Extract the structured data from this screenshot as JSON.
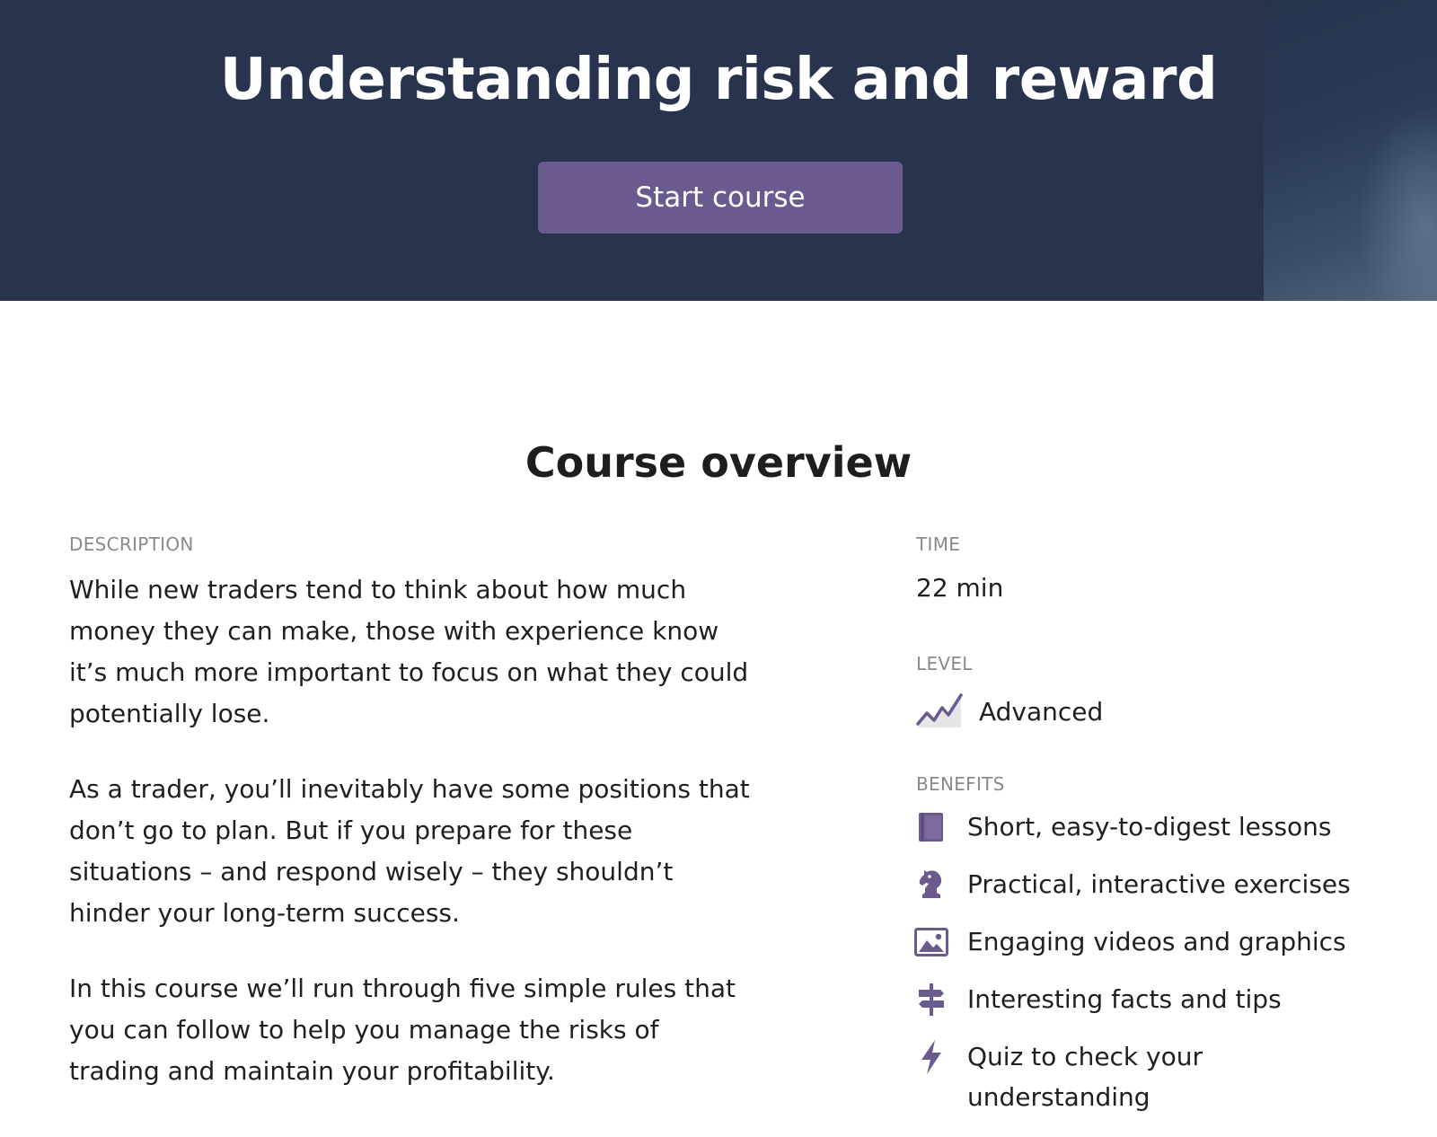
{
  "hero": {
    "title": "Understanding risk and reward",
    "start_button": "Start course"
  },
  "overview": {
    "title": "Course overview",
    "description_label": "DESCRIPTION",
    "paragraphs": [
      "While new traders tend to think about how much money they can make, those with experience know it’s much more important to focus on what they could potentially lose.",
      "As a trader, you’ll inevitably have some positions that don’t go to plan. But if you prepare for these situations – and respond wisely – they shouldn’t hinder your long-term success.",
      "In this course we’ll run through five simple rules that you can follow to help you manage the risks of trading and maintain your profitability."
    ],
    "time_label": "TIME",
    "time_value": "22 min",
    "level_label": "LEVEL",
    "level_value": "Advanced",
    "level_icon": "advanced-chart-icon",
    "benefits_label": "BENEFITS",
    "benefits": [
      {
        "icon": "book-icon",
        "text": "Short, easy-to-digest lessons"
      },
      {
        "icon": "chess-knight-icon",
        "text": "Practical, interactive exercises"
      },
      {
        "icon": "image-icon",
        "text": "Engaging videos and graphics"
      },
      {
        "icon": "signpost-icon",
        "text": "Interesting facts and tips"
      },
      {
        "icon": "lightning-icon",
        "text": "Quiz to check your understanding"
      }
    ]
  },
  "colors": {
    "hero_bg": "#28344e",
    "accent": "#6b5a8e",
    "label_gray": "#8a8a8a"
  }
}
